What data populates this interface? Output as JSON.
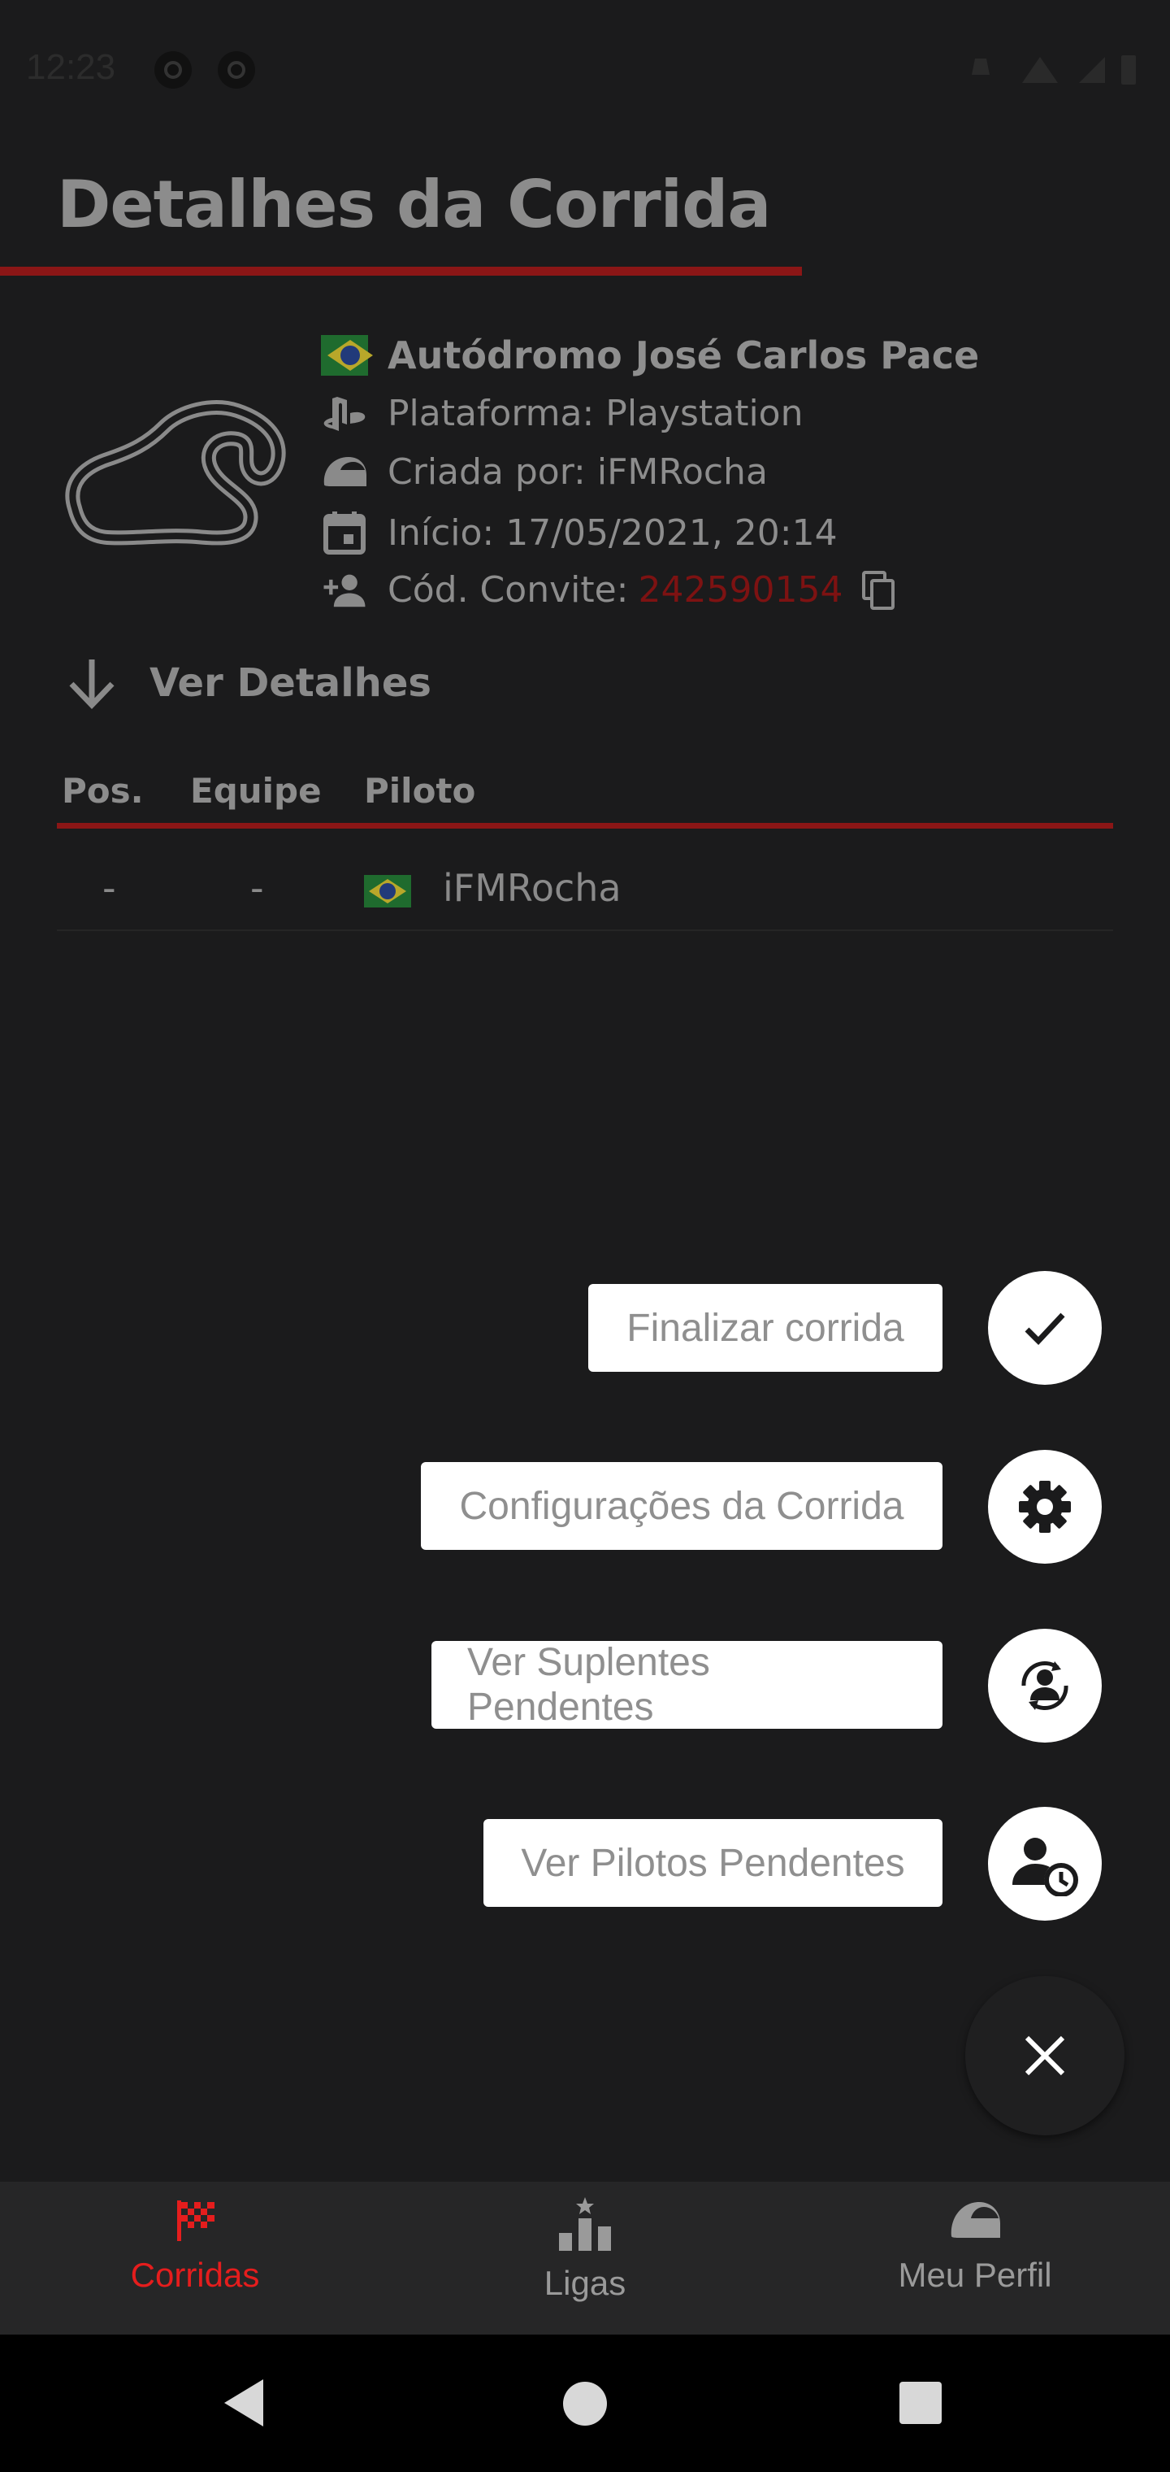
{
  "status_bar": {
    "time": "12:23"
  },
  "page": {
    "title": "Detalhes da Corrida"
  },
  "race": {
    "circuit": "Autódromo José Carlos Pace",
    "platform": "Plataforma: Playstation",
    "created_by": "Criada por: iFMRocha",
    "start": "Início: 17/05/2021, 20:14",
    "invite_label": "Cód. Convite: ",
    "invite_code": "242590154",
    "details_toggle": "Ver Detalhes"
  },
  "table": {
    "headers": [
      "Pos.",
      "Equipe",
      "Piloto"
    ],
    "rows": [
      {
        "pos": "-",
        "team": "-",
        "driver": "iFMRocha"
      }
    ]
  },
  "fab_menu": {
    "actions": [
      {
        "label": "Finalizar corrida",
        "icon": "check-icon"
      },
      {
        "label": "Configurações da Corrida",
        "icon": "gear-icon"
      },
      {
        "label": "Ver Suplentes Pendentes",
        "icon": "person-swap-icon"
      },
      {
        "label": "Ver Pilotos Pendentes",
        "icon": "person-clock-icon"
      }
    ],
    "close_icon": "close-icon"
  },
  "bottom_nav": {
    "items": [
      {
        "label": "Corridas",
        "icon": "checkered-flag-icon",
        "active": true
      },
      {
        "label": "Ligas",
        "icon": "podium-icon",
        "active": false
      },
      {
        "label": "Meu Perfil",
        "icon": "helmet-icon",
        "active": false
      }
    ],
    "active_color": "#e51d1d",
    "inactive_color": "#9a9a9a"
  },
  "colors": {
    "accent": "#8b1616",
    "background": "#1b1b1c"
  }
}
